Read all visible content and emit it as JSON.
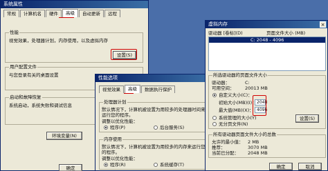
{
  "sysprops": {
    "title": "系统属性",
    "tabs": [
      "常规",
      "计算机名",
      "硬件",
      "高级",
      "自动更新",
      "远程"
    ],
    "perf_group": "性能",
    "perf_desc": "视觉效果，处理器计划，内存使用，以及虚拟内存",
    "settings_btn": "设置(S)",
    "profile_group": "用户配置文件",
    "profile_desc": "与您登录有关的桌面设置",
    "startup_group": "启动和故障恢复",
    "startup_desc": "系统启动，系统失败和调试信息",
    "env_btn": "环境变量(N)",
    "ok_btn": "确定"
  },
  "perfopts": {
    "title": "性能选项",
    "tabs": [
      "视觉效果",
      "高级",
      "数据执行保护"
    ],
    "cpu_group": "处理器计划",
    "cpu_desc": "默认情况下，计算机被设置为用较多的处理器时间来运行您的程序。",
    "adjust_label": "调整以优化性能：",
    "radio_programs": "程序(P)",
    "radio_bgservices": "后台服务(S)",
    "mem_group": "内存使用",
    "mem_desc": "默认情况下，计算机被设置为用较多的内存来运行您的程序。",
    "adjust_label2": "调整以优化性能：",
    "radio_programs2": "程序(R)",
    "radio_cache": "系统缓存(T)"
  },
  "vmem": {
    "title": "虚拟内存",
    "col_drive": "驱动器 [卷标](D)",
    "col_size": "页面文件大小 (MB)",
    "selected_row": "C:      2048 - 4096",
    "group": "所选驱动器的页面文件大小",
    "drive_label": "驱动器：",
    "drive_value": "C:",
    "space_label": "可用空间：",
    "space_value": "20013 MB",
    "custom_label": "自定义大小(C)：",
    "initial_label": "初始大小(MB)(I)：",
    "initial_value": "2048",
    "max_label": "最大值(MB)(X)：",
    "max_value": "4096",
    "sysmanaged": "系统管理的大小(Y)",
    "nopaging": "无分页文件(N)",
    "set_btn": "设置(S)",
    "total_group": "所有驱动器页面文件大小的总数",
    "min_label": "允许的最小值：",
    "min_value": "2 MB",
    "rec_label": "推荐：",
    "rec_value": "3070 MB",
    "cur_label": "当前已分配：",
    "cur_value": "2048 MB",
    "ok_btn": "确定",
    "cancel_btn": "取消"
  },
  "colors": {
    "accent": "#0a246a",
    "annotation": "#d00000"
  }
}
